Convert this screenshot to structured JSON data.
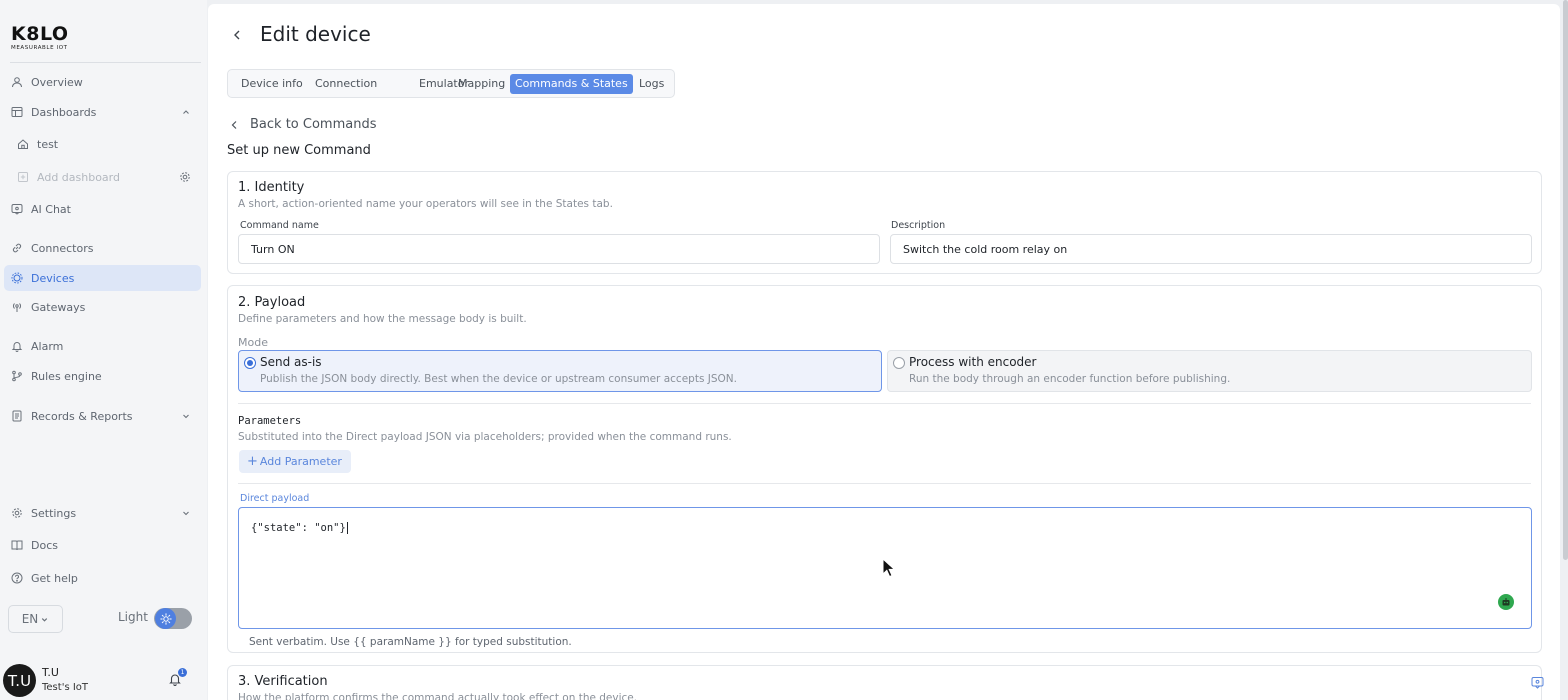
{
  "brand": {
    "name": "K8LO",
    "tagline": "MEASURABLE IOT"
  },
  "sidebar": {
    "items": [
      {
        "key": "overview",
        "label": "Overview",
        "icon": "user-icon"
      },
      {
        "key": "dashboards",
        "label": "Dashboards",
        "icon": "dashboard-icon",
        "expanded": true
      },
      {
        "key": "test",
        "label": "test",
        "icon": "home-icon"
      },
      {
        "key": "add-dashboard",
        "label": "Add dashboard",
        "icon": "plus-square-icon"
      },
      {
        "key": "ai-chat",
        "label": "AI Chat",
        "icon": "chat-icon"
      },
      {
        "key": "connectors",
        "label": "Connectors",
        "icon": "link-icon"
      },
      {
        "key": "devices",
        "label": "Devices",
        "icon": "chip-icon",
        "active": true
      },
      {
        "key": "gateways",
        "label": "Gateways",
        "icon": "antenna-icon"
      },
      {
        "key": "alarm",
        "label": "Alarm",
        "icon": "bell-icon"
      },
      {
        "key": "rules-engine",
        "label": "Rules engine",
        "icon": "branch-icon"
      },
      {
        "key": "records-reports",
        "label": "Records & Reports",
        "icon": "report-icon"
      },
      {
        "key": "settings",
        "label": "Settings",
        "icon": "gear-icon"
      },
      {
        "key": "docs",
        "label": "Docs",
        "icon": "book-icon"
      },
      {
        "key": "get-help",
        "label": "Get help",
        "icon": "help-icon"
      }
    ],
    "language": "EN",
    "theme_label": "Light",
    "user": {
      "initials": "T.U",
      "name": "T.U",
      "org": "Test's IoT",
      "notifications": "1"
    }
  },
  "header": {
    "title": "Edit device"
  },
  "tabs": [
    {
      "label": "Device info"
    },
    {
      "label": "Connection"
    },
    {
      "label": "Emulator"
    },
    {
      "label": "Mapping"
    },
    {
      "label": "Commands & States",
      "active": true
    },
    {
      "label": "Logs"
    }
  ],
  "back_link": "Back to Commands",
  "form_title": "Set up new Command",
  "identity": {
    "title": "1. Identity",
    "desc": "A short, action-oriented name your operators will see in the States tab.",
    "command_name_label": "Command name",
    "command_name_value": "Turn ON",
    "description_label": "Description",
    "description_value": "Switch the cold room relay on"
  },
  "payload": {
    "title": "2. Payload",
    "desc": "Define parameters and how the message body is built.",
    "mode_label": "Mode",
    "modes": [
      {
        "name": "Send as-is",
        "desc": "Publish the JSON body directly. Best when the device or upstream consumer accepts JSON.",
        "selected": true
      },
      {
        "name": "Process with encoder",
        "desc": "Run the body through an encoder function before publishing.",
        "selected": false
      }
    ],
    "params_title": "Parameters",
    "params_desc": "Substituted into the Direct payload JSON via placeholders; provided when the command runs.",
    "add_param_label": "Add Parameter",
    "direct_payload_label": "Direct payload",
    "direct_payload_value": "{\"state\": \"on\"}",
    "hint": "Sent verbatim. Use {{ paramName }} for typed substitution."
  },
  "verification": {
    "title": "3. Verification",
    "desc": "How the platform confirms the command actually took effect on the device."
  },
  "colors": {
    "accent": "#5b8ae6",
    "active_bg": "#dde6f7",
    "bot": "#2fa84f"
  }
}
